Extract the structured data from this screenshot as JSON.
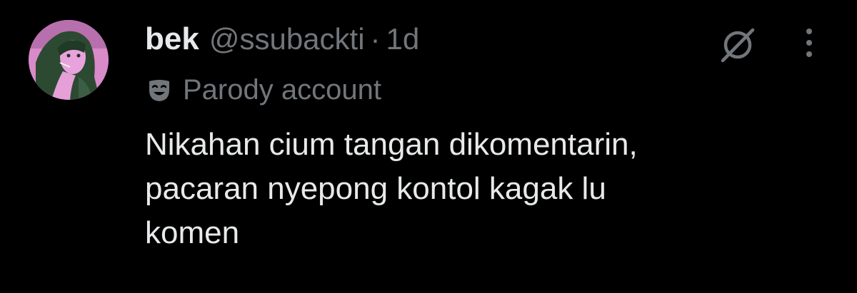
{
  "tweet": {
    "author_name": "bek",
    "handle": "@ssubackti",
    "separator": "·",
    "time": "1d",
    "parody_label": "Parody account",
    "text": "Nikahan cium tangan dikomentarin,\npacaran nyepong kontol kagak lu\nkomen"
  },
  "icons": {
    "grok": "grok-icon",
    "more": "more-vertical-icon",
    "parody": "parody-mask-icon",
    "avatar": "avatar"
  },
  "colors": {
    "background": "#000000",
    "primary_text": "#e7e9ea",
    "secondary_text": "#71767b",
    "avatar_tint": "#e07ad0",
    "avatar_shade": "#2f5a3a"
  }
}
